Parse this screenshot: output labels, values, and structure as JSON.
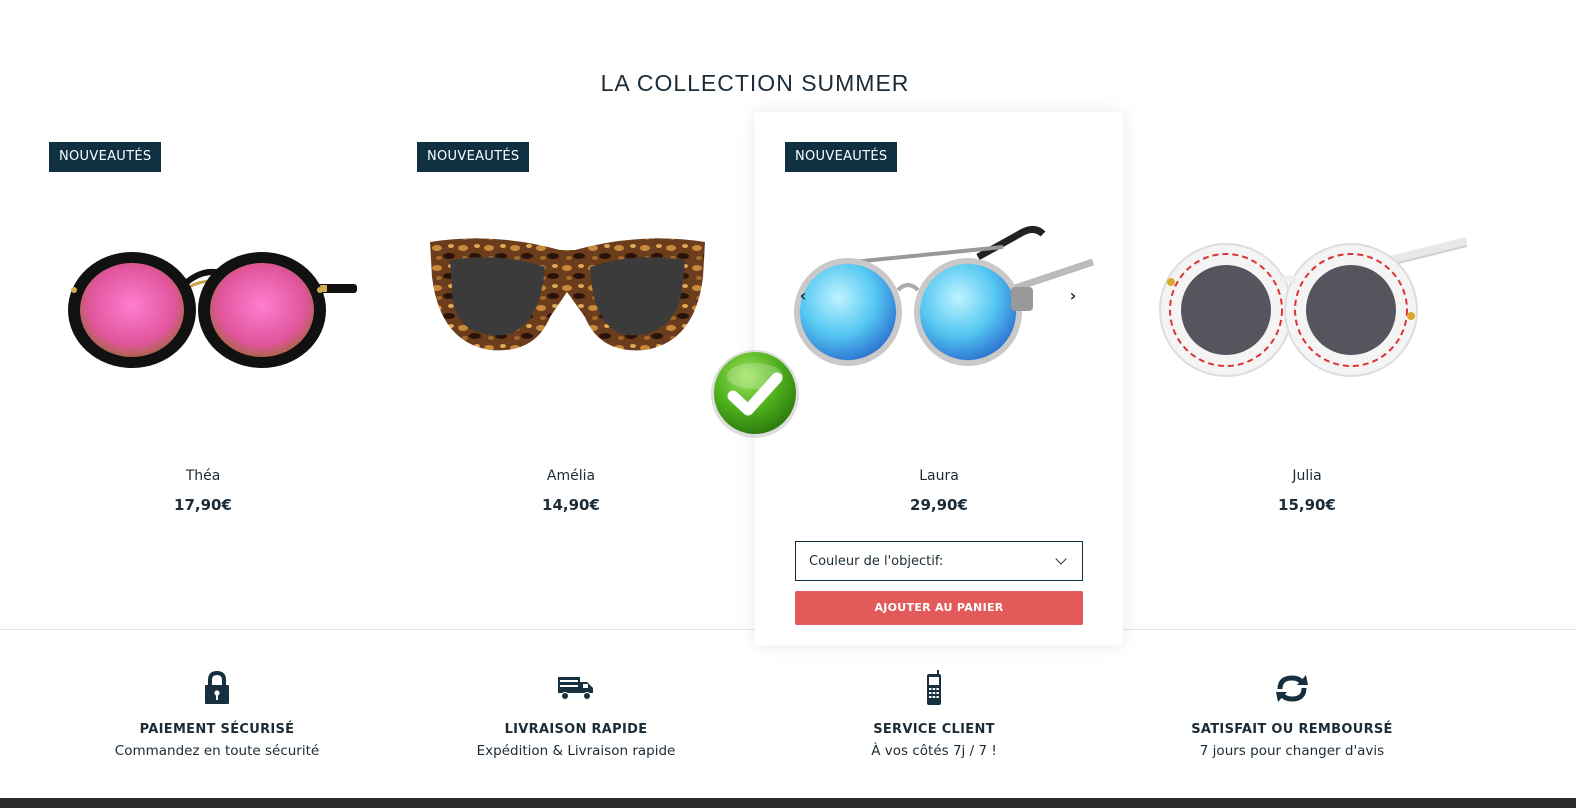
{
  "section": {
    "title": "LA COLLECTION SUMMER"
  },
  "products": [
    {
      "badge": "NOUVEAUTÉS",
      "name": "Théa",
      "price": "17,90€"
    },
    {
      "badge": "NOUVEAUTÉS",
      "name": "Amélia",
      "price": "14,90€"
    },
    {
      "badge": "NOUVEAUTÉS",
      "name": "Laura",
      "price": "29,90€",
      "select_label": "Couleur de l'objectif:",
      "cart_label": "AJOUTER AU PANIER"
    },
    {
      "name": "Julia",
      "price": "15,90€"
    }
  ],
  "features": [
    {
      "icon": "lock-icon",
      "title": "PAIEMENT SÉCURISÉ",
      "subtitle": "Commandez en toute sécurité"
    },
    {
      "icon": "truck-icon",
      "title": "LIVRAISON RAPIDE",
      "subtitle": "Expédition & Livraison rapide"
    },
    {
      "icon": "mobile-phone-icon",
      "title": "SERVICE CLIENT",
      "subtitle": "À vos côtés 7j / 7 !"
    },
    {
      "icon": "refresh-icon",
      "title": "SATISFAIT OU REMBOURSÉ",
      "subtitle": "7 jours pour changer d'avis"
    }
  ],
  "colors": {
    "badge": "#0f3040",
    "cart_button": "#e35a5a",
    "text": "#1c2b36",
    "check": "#5cb82a"
  }
}
